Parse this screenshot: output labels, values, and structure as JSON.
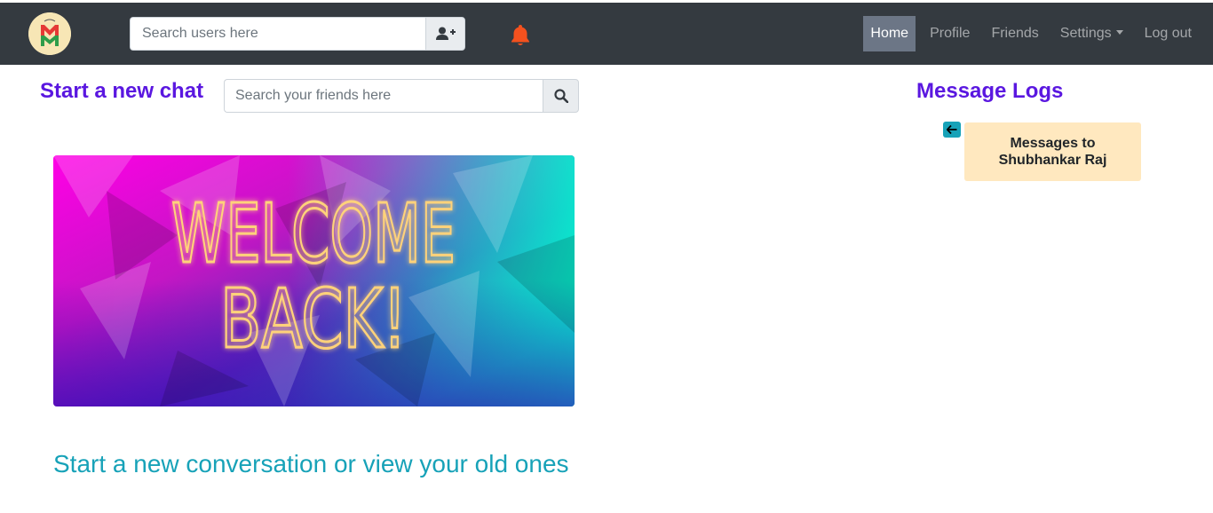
{
  "navbar": {
    "logo_letter": "M",
    "user_search": {
      "placeholder": "Search users here",
      "value": ""
    },
    "add_user_icon": "user-plus-icon",
    "notification_icon": "bell-icon",
    "notification_color": "#f4511e",
    "links": [
      {
        "label": "Home",
        "active": true
      },
      {
        "label": "Profile",
        "active": false
      },
      {
        "label": "Friends",
        "active": false
      },
      {
        "label": "Settings",
        "active": false,
        "dropdown": true
      },
      {
        "label": "Log out",
        "active": false
      }
    ]
  },
  "main": {
    "title": "Start a new chat",
    "friend_search": {
      "placeholder": "Search your friends here",
      "value": ""
    },
    "search_icon": "search-icon",
    "welcome_banner": {
      "line1": "WELCOME",
      "line2": "BACK!"
    },
    "subtitle": "Start a new conversation or view your old ones"
  },
  "logs": {
    "title": "Message Logs",
    "back_icon": "arrow-left-icon",
    "card_text": "Messages to Shubhankar Raj"
  },
  "colors": {
    "navbar_bg": "#343a40",
    "heading": "#5a17e0",
    "subtitle": "#17a2b8",
    "card_bg": "#ffe8bf",
    "active_nav_bg": "#6c7686"
  }
}
